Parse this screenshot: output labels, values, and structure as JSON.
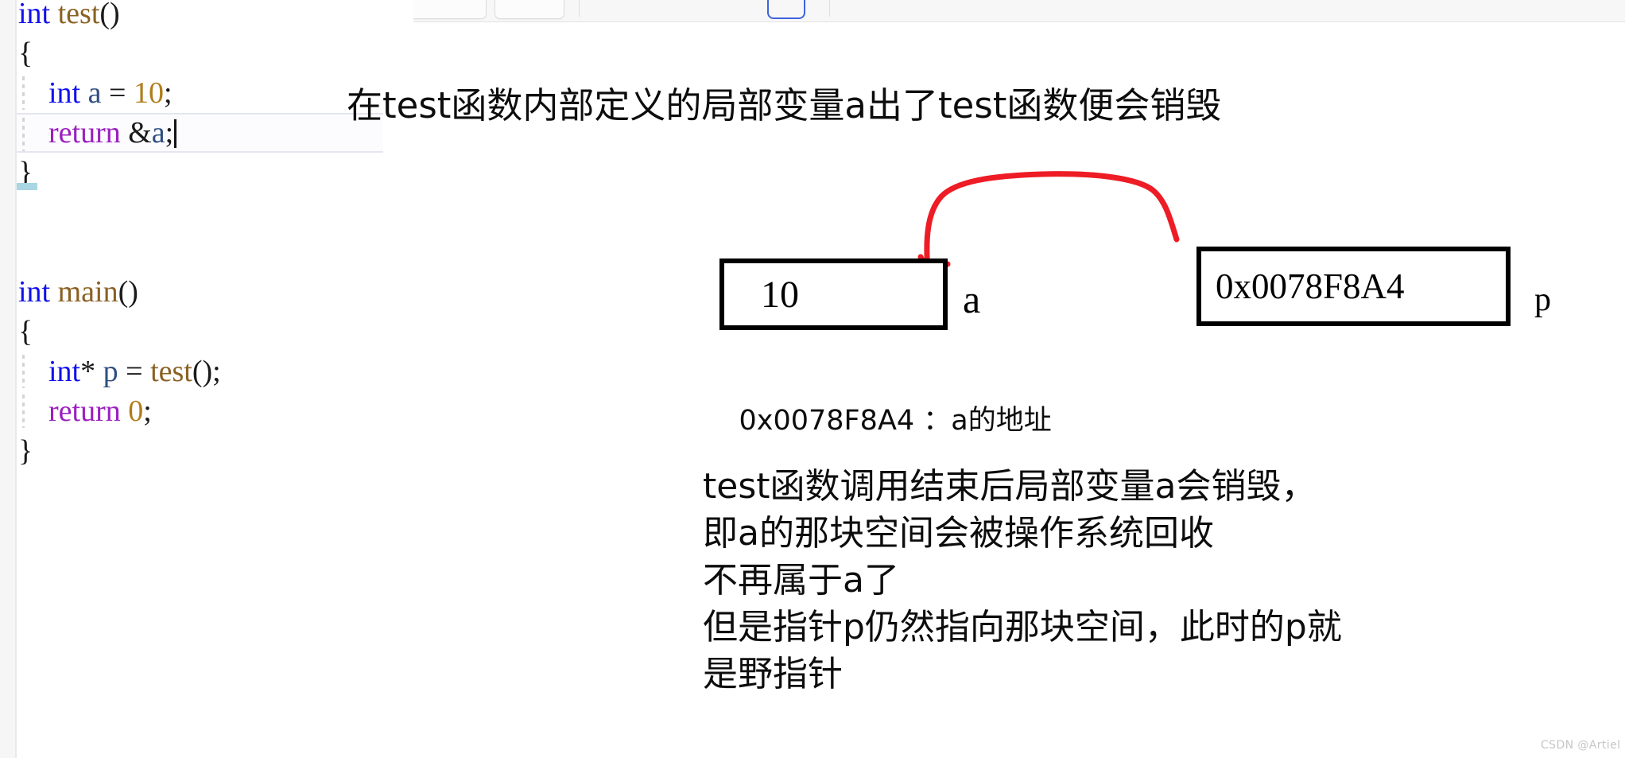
{
  "toolbar": {
    "fields": [
      {
        "name": "wide-input",
        "kind": "wide"
      },
      {
        "name": "small-input",
        "kind": "small"
      }
    ],
    "icons": [
      "bold-icon",
      "italic-icon",
      "underline-icon",
      "highlight-icon",
      "shape-tool-icon",
      "eraser-icon"
    ]
  },
  "editor": {
    "language": "c",
    "caret_line_index": 3,
    "lines": [
      {
        "indent_guide": false,
        "tokens": [
          {
            "t": "int",
            "c": "kw"
          },
          {
            "t": " ",
            "c": "plain"
          },
          {
            "t": "test",
            "c": "fn"
          },
          {
            "t": "()",
            "c": "punct"
          }
        ]
      },
      {
        "indent_guide": false,
        "tokens": [
          {
            "t": "{",
            "c": "punct"
          }
        ]
      },
      {
        "indent_guide": true,
        "tokens": [
          {
            "t": "    ",
            "c": "plain"
          },
          {
            "t": "int",
            "c": "kw"
          },
          {
            "t": " ",
            "c": "plain"
          },
          {
            "t": "a",
            "c": "var"
          },
          {
            "t": " = ",
            "c": "plain"
          },
          {
            "t": "10",
            "c": "num"
          },
          {
            "t": ";",
            "c": "punct"
          }
        ]
      },
      {
        "indent_guide": true,
        "active": true,
        "tokens": [
          {
            "t": "    ",
            "c": "plain"
          },
          {
            "t": "return",
            "c": "kw2"
          },
          {
            "t": " ",
            "c": "plain"
          },
          {
            "t": "&",
            "c": "punct"
          },
          {
            "t": "a",
            "c": "var"
          },
          {
            "t": ";",
            "c": "punct"
          }
        ]
      },
      {
        "indent_guide": false,
        "tokens": [
          {
            "t": "}",
            "c": "punct"
          }
        ]
      },
      {
        "indent_guide": false,
        "tokens": []
      },
      {
        "indent_guide": false,
        "tokens": []
      },
      {
        "indent_guide": false,
        "tokens": [
          {
            "t": "int",
            "c": "kw"
          },
          {
            "t": " ",
            "c": "plain"
          },
          {
            "t": "main",
            "c": "fn"
          },
          {
            "t": "()",
            "c": "punct"
          }
        ]
      },
      {
        "indent_guide": false,
        "tokens": [
          {
            "t": "{",
            "c": "punct"
          }
        ]
      },
      {
        "indent_guide": true,
        "tokens": [
          {
            "t": "    ",
            "c": "plain"
          },
          {
            "t": "int",
            "c": "kw"
          },
          {
            "t": "*",
            "c": "punct"
          },
          {
            "t": " ",
            "c": "plain"
          },
          {
            "t": "p",
            "c": "var"
          },
          {
            "t": " = ",
            "c": "plain"
          },
          {
            "t": "test",
            "c": "fn"
          },
          {
            "t": "();",
            "c": "punct"
          }
        ]
      },
      {
        "indent_guide": true,
        "tokens": [
          {
            "t": "    ",
            "c": "plain"
          },
          {
            "t": "return",
            "c": "kw2"
          },
          {
            "t": " ",
            "c": "plain"
          },
          {
            "t": "0",
            "c": "num"
          },
          {
            "t": ";",
            "c": "punct"
          }
        ]
      },
      {
        "indent_guide": false,
        "tokens": [
          {
            "t": "}",
            "c": "punct"
          }
        ]
      }
    ]
  },
  "annotations": {
    "top_note": "在test函数内部定义的局部变量a出了test函数便会销毁",
    "box_a_value": "10",
    "box_a_label": "a",
    "box_p_value": "0x0078F8A4",
    "box_p_label": "p",
    "address_caption": "0x0078F8A4 ：a的地址",
    "explanation_lines": [
      "test函数调用结束后局部变量a会销毁，",
      "即a的那块空间会被操作系统回收",
      "不再属于a了",
      "但是指针p仍然指向那块空间，此时的p就",
      "是野指针"
    ]
  },
  "colors": {
    "keyword": "#1111ee",
    "keyword_return": "#9b1fbf",
    "function": "#8a6123",
    "number": "#b07d1c",
    "variable": "#2f4f7f",
    "arrow_red": "#ee1c25",
    "box_border": "#000000",
    "active_line_border": "#e5e6f2",
    "blue_marker": "#a9d6e3",
    "watermark": "#c6c6c6"
  },
  "watermark": "CSDN @Artiel"
}
